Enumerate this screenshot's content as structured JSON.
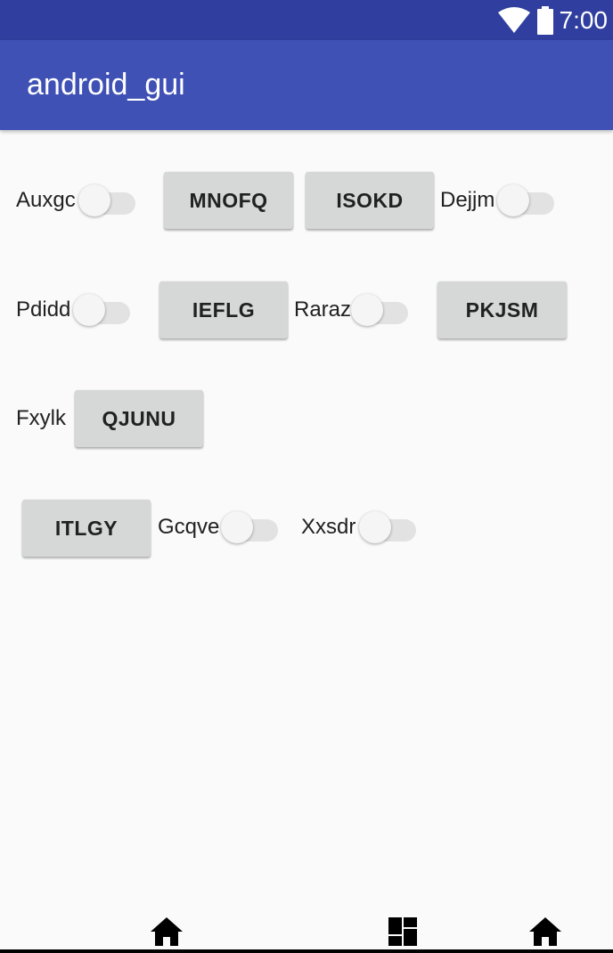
{
  "status_bar": {
    "time": "7:00",
    "icons": [
      "wifi-icon",
      "battery-icon"
    ]
  },
  "app_bar": {
    "title": "android_gui"
  },
  "rows": {
    "row1": {
      "label1": "Auxgc",
      "button1": "MNOFQ",
      "button2": "ISOKD",
      "label2": "Dejjm"
    },
    "row2": {
      "label1": "Pdidd",
      "button1": "IEFLG",
      "label2": "Raraz",
      "button2": "PKJSM"
    },
    "row3": {
      "label1": "Fxylk",
      "button1": "QJUNU"
    },
    "row4": {
      "button1": "ITLGY",
      "label1": "Gcqve",
      "label2": "Xxsdr"
    }
  },
  "switches": {
    "auxgc": false,
    "dejjm": false,
    "pdidd": false,
    "raraz": false,
    "gcqve": false,
    "xxsdr": false
  },
  "nav_bar": {
    "icons": [
      "home-icon",
      "dashboard-icon",
      "home-icon"
    ]
  },
  "colors": {
    "status_bar": "#303f9f",
    "app_bar": "#3f51b5",
    "background": "#fafafa",
    "button": "#d6d7d7"
  }
}
